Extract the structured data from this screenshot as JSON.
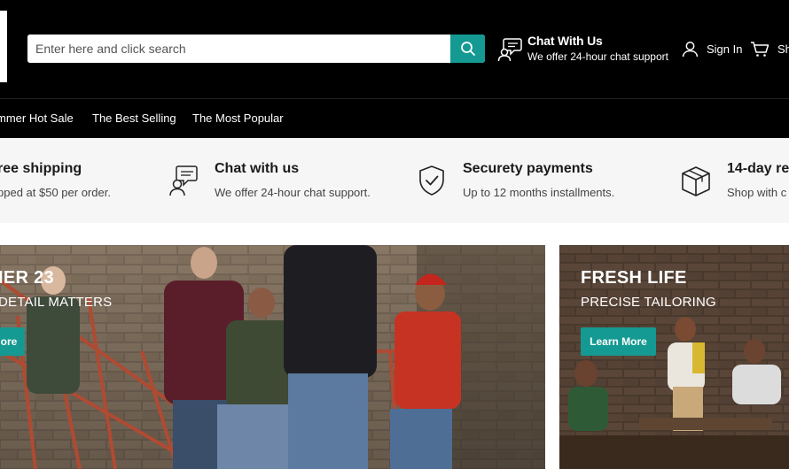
{
  "header": {
    "search": {
      "placeholder": "Enter here and click search",
      "icon": "search-icon"
    },
    "chat": {
      "title": "Chat With Us",
      "subtitle": "We offer 24-hour chat support",
      "icon": "chat-support-icon"
    },
    "signin": {
      "label": "Sign In",
      "icon": "user-icon"
    },
    "cart": {
      "label": "Sh",
      "icon": "cart-icon"
    }
  },
  "nav": {
    "items": [
      {
        "label": "mmer Hot Sale"
      },
      {
        "label": "The Best Selling"
      },
      {
        "label": "The Most Popular"
      }
    ]
  },
  "features": [
    {
      "title": "ree shipping",
      "subtitle": "pped at $50 per order.",
      "icon": "shipping-icon"
    },
    {
      "title": "Chat with us",
      "subtitle": "We offer 24-hour chat support.",
      "icon": "chat-icon"
    },
    {
      "title": "Securety payments",
      "subtitle": "Up to 12 months installments.",
      "icon": "shield-check-icon"
    },
    {
      "title": "14-day re",
      "subtitle": "Shop with c",
      "icon": "box-icon"
    }
  ],
  "banners": {
    "main": {
      "title": "IER 23",
      "subtitle": "DETAIL MATTERS",
      "button": "ore"
    },
    "side": {
      "title": "FRESH LIFE",
      "subtitle": "PRECISE TAILORING",
      "button": "Learn More"
    }
  },
  "colors": {
    "accent": "#149a92",
    "header_bg": "#000000",
    "features_bg": "#f6f6f6"
  }
}
